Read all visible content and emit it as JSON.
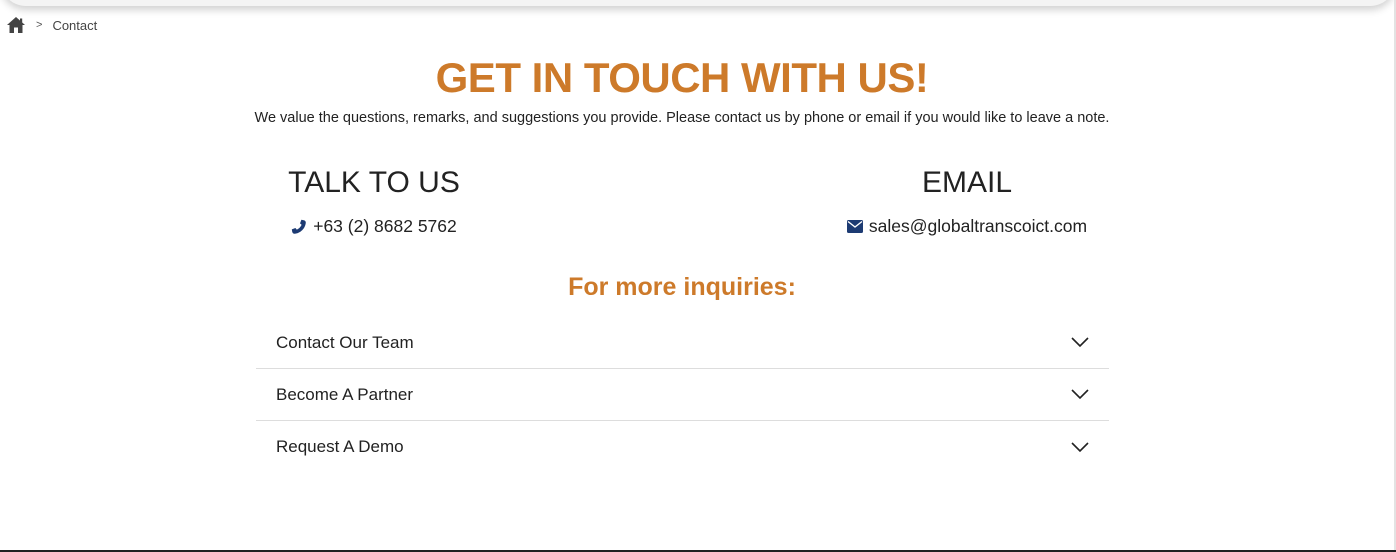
{
  "breadcrumb": {
    "home_icon": "home-icon",
    "separator": ">",
    "current": "Contact"
  },
  "hero": {
    "title": "GET IN TOUCH WITH US!",
    "subtitle": "We value the questions, remarks, and suggestions you provide. Please contact us by phone or email if you would like to leave a note."
  },
  "talk": {
    "heading": "TALK TO US",
    "icon": "phone-icon",
    "phone": "+63 (2) 8682 5762"
  },
  "email": {
    "heading": "EMAIL",
    "icon": "envelope-icon",
    "address": "sales@globaltranscoict.com"
  },
  "inquiries": {
    "title": "For more inquiries:",
    "items": [
      {
        "label": "Contact Our Team",
        "icon": "chevron-down-icon"
      },
      {
        "label": "Become A Partner",
        "icon": "chevron-down-icon"
      },
      {
        "label": "Request A Demo",
        "icon": "chevron-down-icon"
      }
    ]
  },
  "colors": {
    "accent": "#cd7a2a",
    "icon_blue": "#1d3b73",
    "text": "#222222"
  }
}
